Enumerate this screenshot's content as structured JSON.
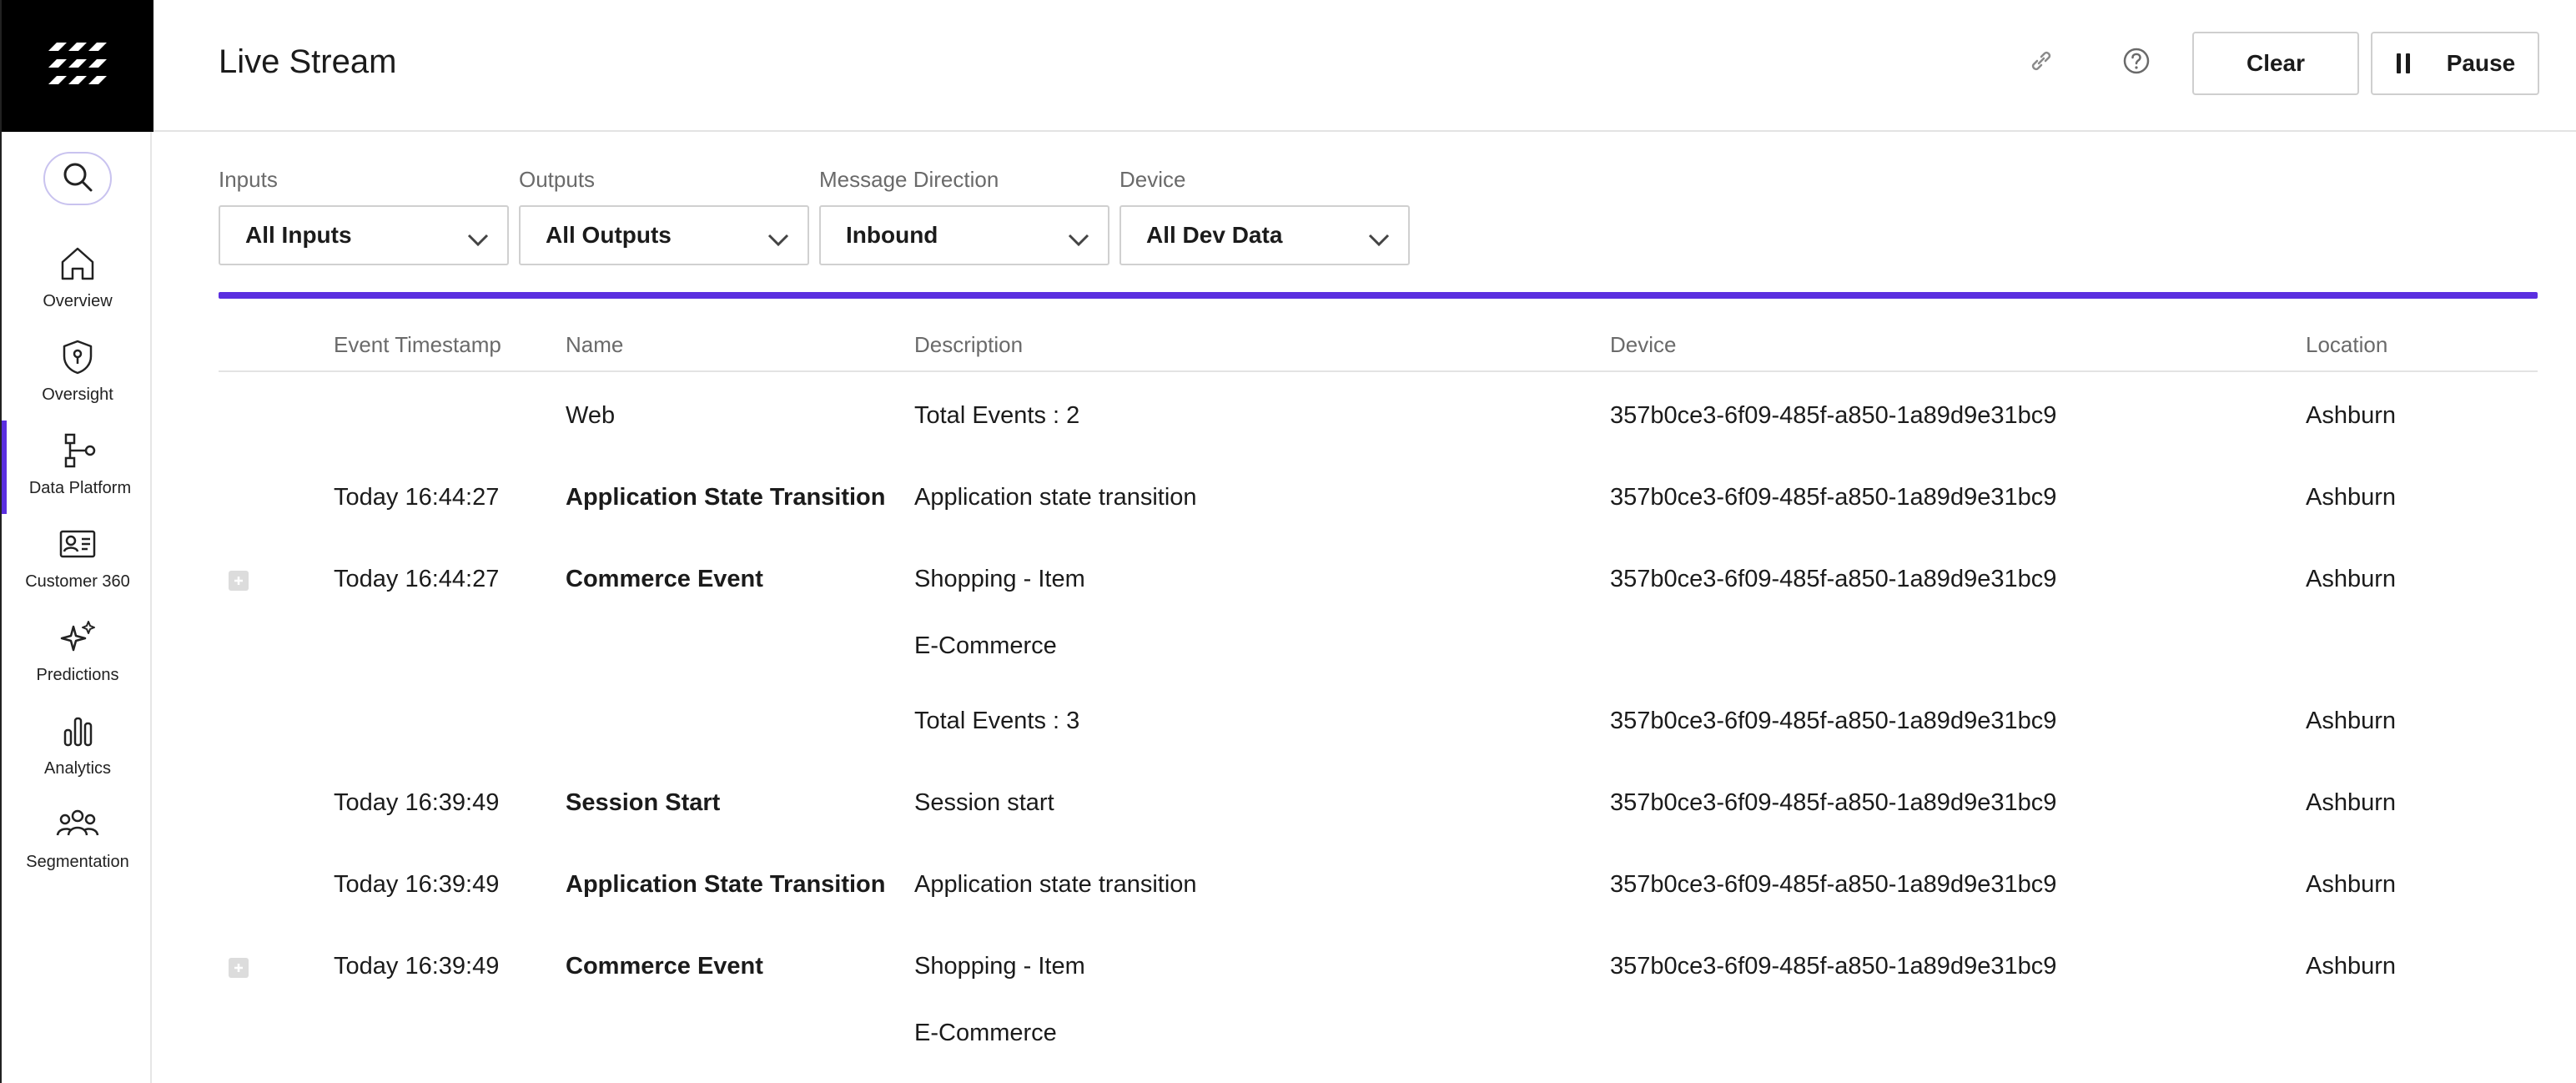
{
  "sidebar": {
    "logo_icon": "brand-logo-icon",
    "search_icon": "search-icon",
    "items": [
      {
        "label": "Overview",
        "icon": "home-icon"
      },
      {
        "label": "Oversight",
        "icon": "shield-icon"
      },
      {
        "label": "Data Platform",
        "icon": "data-flow-icon",
        "active": true
      },
      {
        "label": "Customer 360",
        "icon": "id-card-icon"
      },
      {
        "label": "Predictions",
        "icon": "sparkles-icon"
      },
      {
        "label": "Analytics",
        "icon": "bar-chart-icon"
      },
      {
        "label": "Segmentation",
        "icon": "users-group-icon"
      }
    ]
  },
  "header": {
    "title": "Live Stream",
    "link_icon": "link-icon",
    "help_icon": "help-icon",
    "clear_label": "Clear",
    "pause_label": "Pause",
    "pause_icon": "pause-icon"
  },
  "filters": {
    "inputs": {
      "label": "Inputs",
      "value": "All Inputs"
    },
    "outputs": {
      "label": "Outputs",
      "value": "All Outputs"
    },
    "direction": {
      "label": "Message Direction",
      "value": "Inbound"
    },
    "device": {
      "label": "Device",
      "value": "All Dev Data"
    }
  },
  "accent_color": "#5b2fe0",
  "table": {
    "columns": {
      "timestamp": "Event Timestamp",
      "name": "Name",
      "description": "Description",
      "device": "Device",
      "location": "Location"
    },
    "rows": [
      {
        "timestamp": "",
        "name": "Web",
        "name_bold": false,
        "description": "Total Events : 2",
        "device": "357b0ce3-6f09-485f-a850-1a89d9e31bc9",
        "location": "Ashburn",
        "expandable": false
      },
      {
        "timestamp": "Today 16:44:27",
        "name": "Application State Transition",
        "name_bold": true,
        "description": "Application state transition",
        "device": "357b0ce3-6f09-485f-a850-1a89d9e31bc9",
        "location": "Ashburn",
        "expandable": false
      },
      {
        "timestamp": "Today 16:44:27",
        "name": "Commerce Event",
        "name_bold": true,
        "description": "Shopping - Item",
        "description2": "E-Commerce",
        "device": "357b0ce3-6f09-485f-a850-1a89d9e31bc9",
        "location": "Ashburn",
        "expandable": true
      },
      {
        "timestamp": "",
        "name": "",
        "name_bold": false,
        "description": "Total Events : 3",
        "device": "357b0ce3-6f09-485f-a850-1a89d9e31bc9",
        "location": "Ashburn",
        "expandable": false
      },
      {
        "timestamp": "Today 16:39:49",
        "name": "Session Start",
        "name_bold": true,
        "description": "Session start",
        "device": "357b0ce3-6f09-485f-a850-1a89d9e31bc9",
        "location": "Ashburn",
        "expandable": false
      },
      {
        "timestamp": "Today 16:39:49",
        "name": "Application State Transition",
        "name_bold": true,
        "description": "Application state transition",
        "device": "357b0ce3-6f09-485f-a850-1a89d9e31bc9",
        "location": "Ashburn",
        "expandable": false
      },
      {
        "timestamp": "Today 16:39:49",
        "name": "Commerce Event",
        "name_bold": true,
        "description": "Shopping - Item",
        "description2": "E-Commerce",
        "device": "357b0ce3-6f09-485f-a850-1a89d9e31bc9",
        "location": "Ashburn",
        "expandable": true
      }
    ]
  }
}
